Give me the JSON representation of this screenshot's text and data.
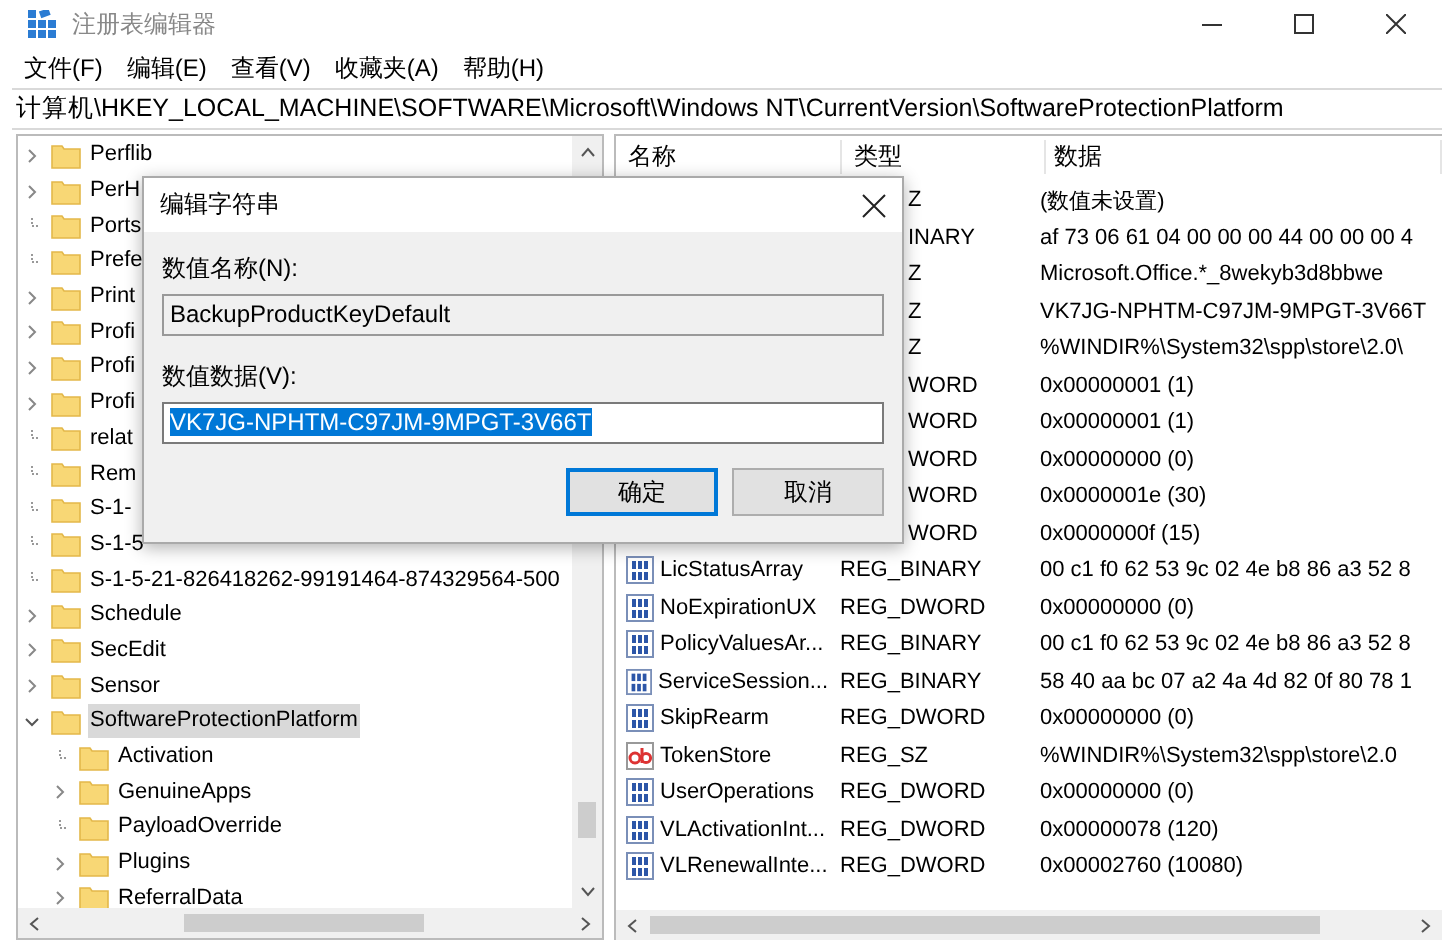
{
  "window": {
    "title": "注册表编辑器"
  },
  "menu": [
    "文件(F)",
    "编辑(E)",
    "查看(V)",
    "收藏夹(A)",
    "帮助(H)"
  ],
  "address": "计算机\\HKEY_LOCAL_MACHINE\\SOFTWARE\\Microsoft\\Windows NT\\CurrentVersion\\SoftwareProtectionPlatform",
  "tree": [
    {
      "label": "Perflib",
      "expandable": true,
      "expanded": false,
      "selected": false
    },
    {
      "label": "PerH",
      "expandable": true,
      "expanded": false,
      "selected": false
    },
    {
      "label": "Ports",
      "expandable": false,
      "expanded": false,
      "selected": false
    },
    {
      "label": "Prefe",
      "expandable": false,
      "expanded": false,
      "selected": false
    },
    {
      "label": "Print",
      "expandable": true,
      "expanded": false,
      "selected": false
    },
    {
      "label": "Profi",
      "expandable": true,
      "expanded": false,
      "selected": false
    },
    {
      "label": "Profi",
      "expandable": true,
      "expanded": false,
      "selected": false
    },
    {
      "label": "Profi",
      "expandable": true,
      "expanded": false,
      "selected": false
    },
    {
      "label": "relat",
      "expandable": false,
      "expanded": false,
      "selected": false
    },
    {
      "label": "Rem",
      "expandable": false,
      "expanded": false,
      "selected": false
    },
    {
      "label": "S-1-",
      "expandable": false,
      "expanded": false,
      "selected": false
    },
    {
      "label": "S-1-5",
      "expandable": false,
      "expanded": false,
      "selected": false
    },
    {
      "label": "S-1-5-21-826418262-99191464-874329564-500",
      "expandable": false,
      "expanded": false,
      "selected": false
    },
    {
      "label": "Schedule",
      "expandable": true,
      "expanded": false,
      "selected": false
    },
    {
      "label": "SecEdit",
      "expandable": true,
      "expanded": false,
      "selected": false
    },
    {
      "label": "Sensor",
      "expandable": true,
      "expanded": false,
      "selected": false
    },
    {
      "label": "SoftwareProtectionPlatform",
      "expandable": true,
      "expanded": true,
      "selected": true,
      "children": [
        {
          "label": "Activation",
          "expandable": false,
          "expanded": false,
          "selected": false
        },
        {
          "label": "GenuineApps",
          "expandable": true,
          "expanded": false,
          "selected": false
        },
        {
          "label": "PayloadOverride",
          "expandable": false,
          "expanded": false,
          "selected": false
        },
        {
          "label": "Plugins",
          "expandable": true,
          "expanded": false,
          "selected": false
        },
        {
          "label": "ReferralData",
          "expandable": true,
          "expanded": false,
          "selected": false
        }
      ]
    }
  ],
  "list": {
    "columns": [
      "名称",
      "类型",
      "数据"
    ],
    "rows": [
      {
        "type": "Z",
        "data": "(数值未设置)"
      },
      {
        "type": "INARY",
        "data": "af 73 06 61 04 00 00 00 44 00 00 00 4"
      },
      {
        "type": "Z",
        "data": "Microsoft.Office.*_8wekyb3d8bbwe"
      },
      {
        "type": "Z",
        "data": "VK7JG-NPHTM-C97JM-9MPGT-3V66T"
      },
      {
        "type": "Z",
        "data": "%WINDIR%\\System32\\spp\\store\\2.0\\"
      },
      {
        "type": "WORD",
        "data": "0x00000001 (1)"
      },
      {
        "type": "WORD",
        "data": "0x00000001 (1)"
      },
      {
        "type": "WORD",
        "data": "0x00000000 (0)"
      },
      {
        "type": "WORD",
        "data": "0x0000001e (30)"
      },
      {
        "type": "WORD",
        "data": "0x0000000f (15)"
      },
      {
        "kind": "binary",
        "name": "LicStatusArray",
        "type": "REG_BINARY",
        "data": "00 c1 f0 62 53 9c 02 4e b8 86 a3 52 8"
      },
      {
        "kind": "binary",
        "name": "NoExpirationUX",
        "type": "REG_DWORD",
        "data": "0x00000000 (0)"
      },
      {
        "kind": "binary",
        "name": "PolicyValuesAr...",
        "type": "REG_BINARY",
        "data": "00 c1 f0 62 53 9c 02 4e b8 86 a3 52 8"
      },
      {
        "kind": "binary",
        "name": "ServiceSession...",
        "type": "REG_BINARY",
        "data": "58 40 aa bc 07 a2 4a 4d 82 0f 80 78 1"
      },
      {
        "kind": "binary",
        "name": "SkipRearm",
        "type": "REG_DWORD",
        "data": "0x00000000 (0)"
      },
      {
        "kind": "string",
        "name": "TokenStore",
        "type": "REG_SZ",
        "data": "%WINDIR%\\System32\\spp\\store\\2.0"
      },
      {
        "kind": "binary",
        "name": "UserOperations",
        "type": "REG_DWORD",
        "data": "0x00000000 (0)"
      },
      {
        "kind": "binary",
        "name": "VLActivationInt...",
        "type": "REG_DWORD",
        "data": "0x00000078 (120)"
      },
      {
        "kind": "binary",
        "name": "VLRenewalInte...",
        "type": "REG_DWORD",
        "data": "0x00002760 (10080)"
      }
    ]
  },
  "dialog": {
    "title": "编辑字符串",
    "name_label": "数值名称(N):",
    "name_value": "BackupProductKeyDefault",
    "data_label": "数值数据(V):",
    "data_value": "VK7JG-NPHTM-C97JM-9MPGT-3V66T",
    "data_selected": true,
    "buttons": [
      {
        "label": "确定",
        "default": true
      },
      {
        "label": "取消",
        "default": false
      }
    ]
  }
}
